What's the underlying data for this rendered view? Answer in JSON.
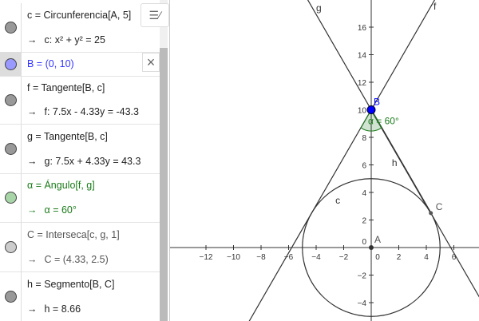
{
  "algebra": [
    {
      "def": "c = Circunferencia[A, 5]",
      "out": "c: x² + y² = 25",
      "color": "#222",
      "dot": "#999"
    },
    {
      "def": "B = (0, 10)",
      "out": null,
      "color": "#3333ff",
      "dot": "#9999ff"
    },
    {
      "def": "f = Tangente[B, c]",
      "out": "f: 7.5x - 4.33y = -43.3",
      "color": "#222",
      "dot": "#999"
    },
    {
      "def": "g = Tangente[B, c]",
      "out": "g: 7.5x + 4.33y = 43.3",
      "color": "#222",
      "dot": "#999"
    },
    {
      "def": "α = Ángulo[f, g]",
      "out": "α = 60°",
      "color": "#1a7a1a",
      "dot": "#a8d5a8"
    },
    {
      "def": "C = Interseca[c, g, 1]",
      "out": "C = (4.33, 2.5)",
      "color": "#555",
      "dot": "#ccc"
    },
    {
      "def": "h = Segmento[B, C]",
      "out": "h = 8.66",
      "color": "#222",
      "dot": "#999"
    }
  ],
  "arrow": "→",
  "style_icon": "style-bar-icon",
  "close_icon": "×",
  "graph": {
    "x_ticks": [
      -12,
      -10,
      -8,
      -6,
      -4,
      -2,
      0,
      2,
      4,
      6
    ],
    "y_ticks": [
      -4,
      -2,
      2,
      4,
      6,
      8,
      10,
      12,
      14,
      16
    ],
    "origin_label": "0",
    "labels": {
      "A": "A",
      "B": "B",
      "C": "C",
      "c": "c",
      "f": "f",
      "g": "g",
      "h": "h",
      "alpha": "α = 60°"
    },
    "B": [
      0,
      10
    ],
    "C": [
      4.33,
      2.5
    ],
    "radius": 5,
    "colors": {
      "point_B": "#0000ff",
      "angle": "#1a7a1a"
    }
  }
}
